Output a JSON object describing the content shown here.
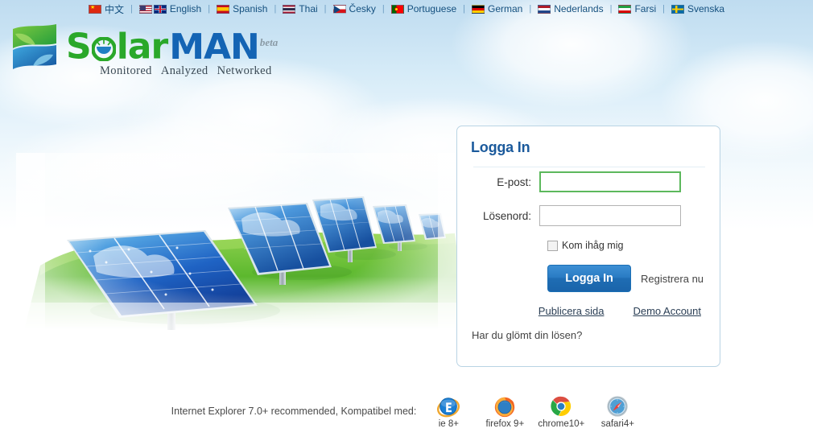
{
  "languages": [
    {
      "label": "中文",
      "flags": [
        "cn"
      ],
      "name": "chinese"
    },
    {
      "label": "English",
      "flags": [
        "us",
        "uk"
      ],
      "name": "english"
    },
    {
      "label": "Spanish",
      "flags": [
        "es"
      ],
      "name": "spanish"
    },
    {
      "label": "Thai",
      "flags": [
        "th"
      ],
      "name": "thai"
    },
    {
      "label": "Česky",
      "flags": [
        "cz"
      ],
      "name": "czech"
    },
    {
      "label": "Portuguese",
      "flags": [
        "pt"
      ],
      "name": "portuguese"
    },
    {
      "label": "German",
      "flags": [
        "de"
      ],
      "name": "german"
    },
    {
      "label": "Nederlands",
      "flags": [
        "nl"
      ],
      "name": "dutch"
    },
    {
      "label": "Farsi",
      "flags": [
        "ir"
      ],
      "name": "farsi"
    },
    {
      "label": "Svenska",
      "flags": [
        "se"
      ],
      "name": "swedish"
    }
  ],
  "separator": "|",
  "logo": {
    "word_first": "S",
    "word_solar_rest": "lar",
    "word_man": "MAN",
    "beta": "beta",
    "tagline": [
      "Monitored",
      "Analyzed",
      "Networked"
    ],
    "color_green": "#2aa82a",
    "color_blue": "#1464b4"
  },
  "login": {
    "title": "Logga In",
    "email_label": "E-post:",
    "email_value": "",
    "email_placeholder": "",
    "password_label": "Lösenord:",
    "password_value": "",
    "password_placeholder": "",
    "remember_label": "Kom ihåg mig",
    "remember_checked": false,
    "submit_label": "Logga In",
    "register_label": "Registrera nu",
    "publish_label": "Publicera sida",
    "demo_label": "Demo Account",
    "forgot_label": "Har du glömt din lösen?",
    "focus_color": "#5cb85c",
    "button_color": "#1f6db4",
    "title_color": "#1b5a9c"
  },
  "footer": {
    "text": "Internet Explorer 7.0+ recommended, Kompatibel med:",
    "browsers": [
      {
        "name": "ie-icon",
        "label": "ie 8+"
      },
      {
        "name": "firefox-icon",
        "label": "firefox 9+"
      },
      {
        "name": "chrome-icon",
        "label": "chrome10+"
      },
      {
        "name": "safari-icon",
        "label": "safari4+"
      }
    ]
  }
}
